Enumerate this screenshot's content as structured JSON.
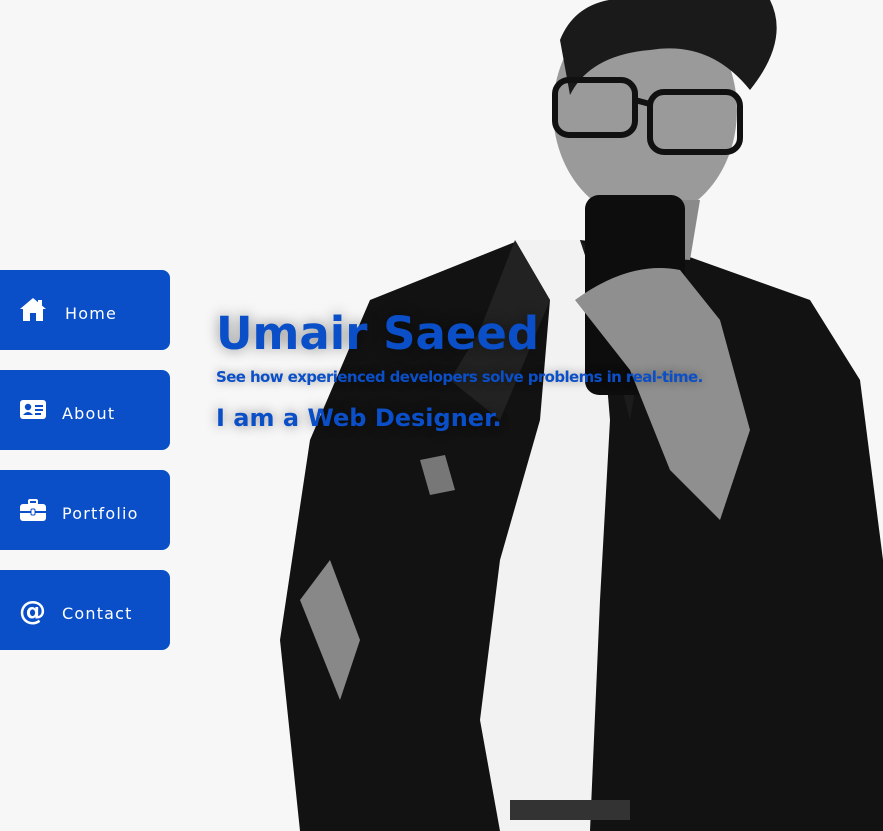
{
  "nav": {
    "items": [
      {
        "label": "Home",
        "icon": "home-icon"
      },
      {
        "label": "About",
        "icon": "id-card-icon"
      },
      {
        "label": "Portfolio",
        "icon": "briefcase-icon"
      },
      {
        "label": "Contact",
        "icon": "at-sign-icon"
      }
    ]
  },
  "intro": {
    "name": "Umair Saeed",
    "subtitle": "See how experienced developers solve problems in real-time.",
    "tagline": "I am a Web Designer."
  },
  "colors": {
    "accent": "#0a4fc8",
    "background": "#f7f7f7",
    "nav_text": "#ffffff"
  }
}
